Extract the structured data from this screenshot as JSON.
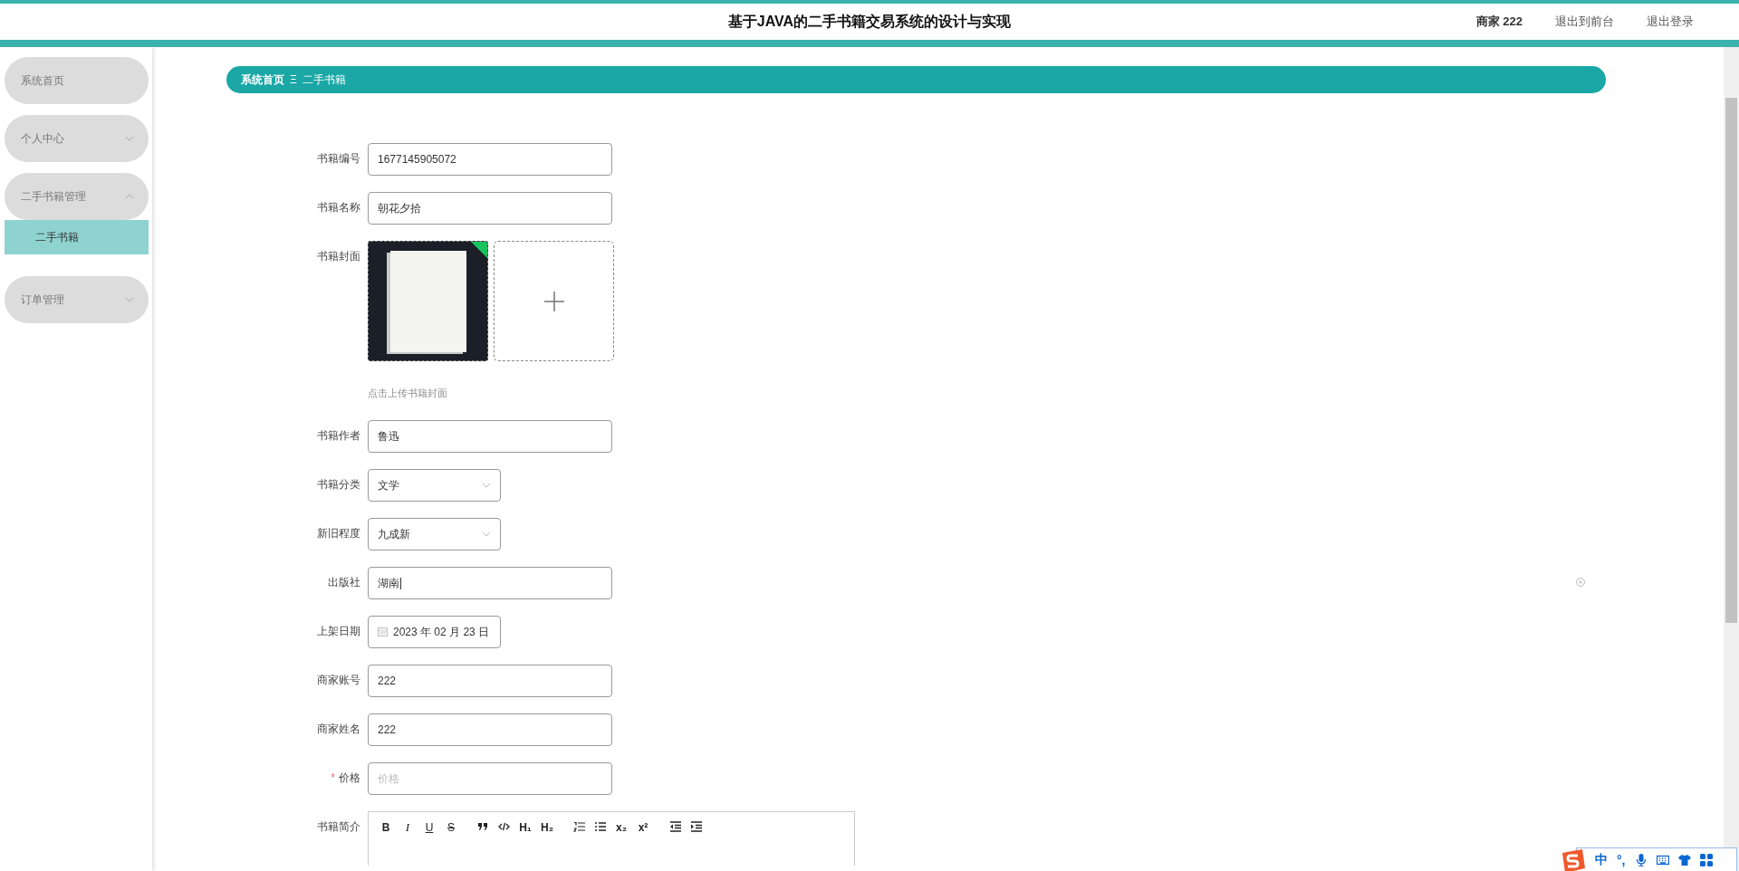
{
  "header": {
    "title": "基于JAVA的二手书籍交易系统的设计与实现",
    "user": "商家 222",
    "links": [
      "退出到前台",
      "退出登录"
    ]
  },
  "sidebar": {
    "items": [
      {
        "label": "系统首页",
        "expandable": false
      },
      {
        "label": "个人中心",
        "expandable": true,
        "expanded": false
      },
      {
        "label": "二手书籍管理",
        "expandable": true,
        "expanded": true,
        "children": [
          {
            "label": "二手书籍",
            "selected": true
          }
        ]
      },
      {
        "label": "订单管理",
        "expandable": true,
        "expanded": false
      }
    ]
  },
  "breadcrumb": {
    "items": [
      "系统首页",
      "二手书籍"
    ],
    "separator": "Ξ"
  },
  "form": {
    "fields": [
      {
        "kind": "text",
        "label": "书籍编号",
        "value": "1677145905072"
      },
      {
        "kind": "text",
        "label": "书籍名称",
        "value": "朝花夕拾"
      },
      {
        "kind": "upload",
        "label": "书籍封面",
        "hint": "点击上传书籍封面"
      },
      {
        "kind": "text",
        "label": "书籍作者",
        "value": "鲁迅"
      },
      {
        "kind": "select",
        "label": "书籍分类",
        "value": "文学"
      },
      {
        "kind": "select",
        "label": "新旧程度",
        "value": "九成新"
      },
      {
        "kind": "text",
        "label": "出版社",
        "value": "湖南",
        "focused": true
      },
      {
        "kind": "date",
        "label": "上架日期",
        "value": "2023 年 02 月 23 日"
      },
      {
        "kind": "text",
        "label": "商家账号",
        "value": "222"
      },
      {
        "kind": "text",
        "label": "商家姓名",
        "value": "222"
      },
      {
        "kind": "text",
        "label": "价格",
        "placeholder": "价格",
        "required_mark": "*"
      },
      {
        "kind": "editor",
        "label": "书籍简介",
        "toolbar": [
          {
            "kind": "bold",
            "label": "B"
          },
          {
            "kind": "italic",
            "label": "I"
          },
          {
            "kind": "underline",
            "label": "U"
          },
          {
            "kind": "strike",
            "label": "S"
          },
          {
            "kind": "quote"
          },
          {
            "kind": "code"
          },
          {
            "kind": "heading",
            "label": "H₁"
          },
          {
            "kind": "heading",
            "label": "H₂"
          },
          {
            "kind": "ordered-list"
          },
          {
            "kind": "bullet-list"
          },
          {
            "kind": "script",
            "label": "x₂"
          },
          {
            "kind": "script",
            "label": "x²"
          },
          {
            "kind": "outdent"
          },
          {
            "kind": "indent"
          }
        ]
      }
    ]
  },
  "ime_bar": {
    "mode": "中",
    "punctuation": "°,"
  }
}
